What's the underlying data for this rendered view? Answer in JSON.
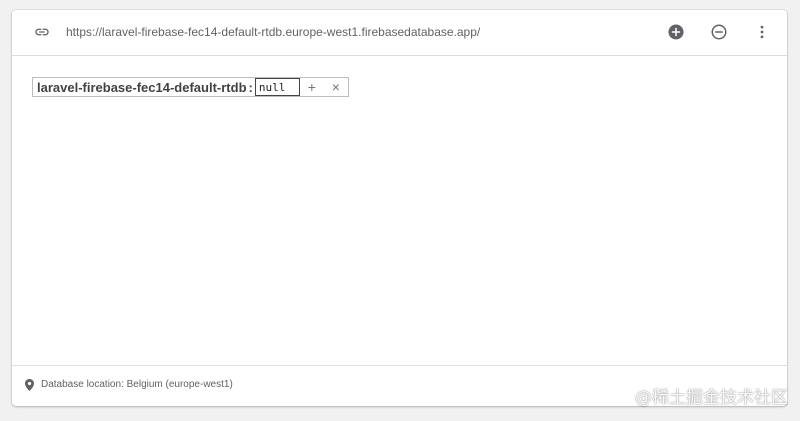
{
  "toolbar": {
    "url": "https://laravel-firebase-fec14-default-rtdb.europe-west1.firebasedatabase.app/",
    "icons": {
      "link": "link-icon",
      "add": "add-circle-icon",
      "remove": "remove-circle-icon",
      "more": "more-vert-icon"
    }
  },
  "tree": {
    "root": {
      "key": "laravel-firebase-fec14-default-rtdb",
      "separator": ":",
      "value": "null",
      "add_symbol": "+",
      "delete_symbol": "×"
    }
  },
  "footer": {
    "location_text": "Database location: Belgium (europe-west1)",
    "icon": "location-pin-icon"
  },
  "watermark": {
    "text": "@稀土掘金技术社区"
  },
  "colors": {
    "accent_icon": "#5f6368",
    "border": "#dcdcdc",
    "background": "#f1f1f1"
  }
}
